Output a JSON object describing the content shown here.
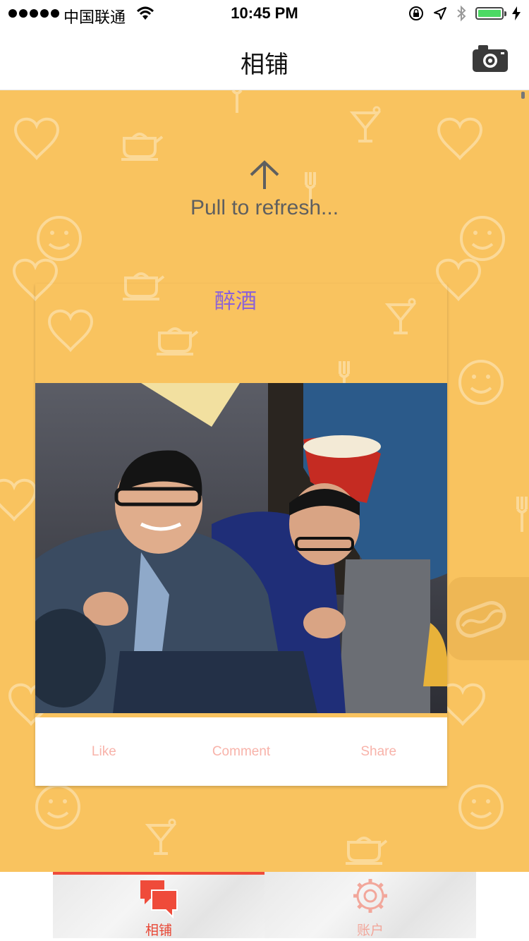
{
  "status_bar": {
    "carrier": "中国联通",
    "time": "10:45 PM"
  },
  "nav": {
    "title": "相铺"
  },
  "refresh": {
    "text": "Pull to refresh..."
  },
  "post": {
    "title": "醉酒",
    "actions": {
      "like": "Like",
      "comment": "Comment",
      "share": "Share"
    }
  },
  "tabs": {
    "feed_label": "相铺",
    "account_label": "账户",
    "active": "feed"
  },
  "colors": {
    "background": "#f9c35f",
    "accent": "#ef4b3a",
    "title_purple": "#8b62d8",
    "action_pink": "#f8b3aa"
  },
  "icons": {
    "camera": "camera-icon",
    "refresh": "arrow-up-icon",
    "feed_tab": "chat-bubbles-icon",
    "account_tab": "gear-icon"
  }
}
